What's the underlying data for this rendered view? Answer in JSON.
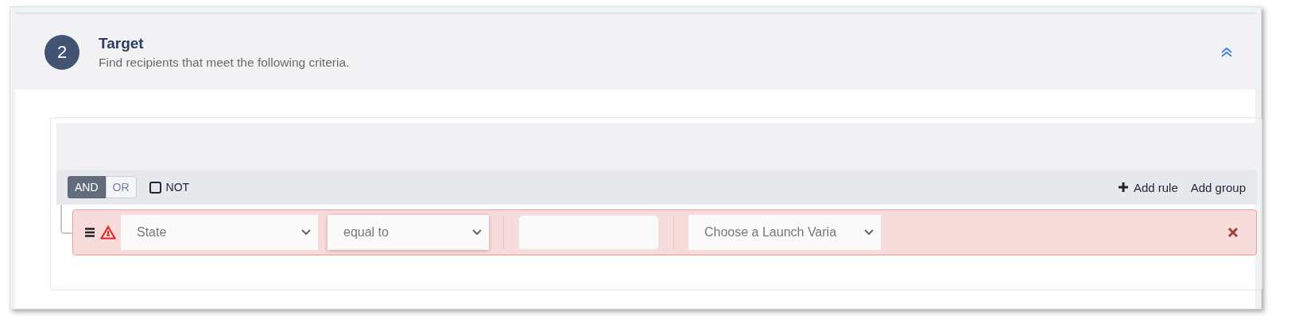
{
  "section": {
    "step": "2",
    "title": "Target",
    "subtitle": "Find recipients that meet the following criteria.",
    "expanded": true
  },
  "query": {
    "conditions": [
      {
        "label": "AND",
        "selected": true
      },
      {
        "label": "OR",
        "selected": false
      }
    ],
    "not": {
      "label": "NOT",
      "checked": false
    },
    "actions": [
      {
        "kind": "add",
        "label": "Add rule"
      },
      {
        "kind": "plain",
        "label": "Add group"
      }
    ],
    "rules": [
      {
        "error": true,
        "field": "State",
        "operator": "equal to",
        "variable": "Choose a Launch Varia"
      }
    ]
  }
}
